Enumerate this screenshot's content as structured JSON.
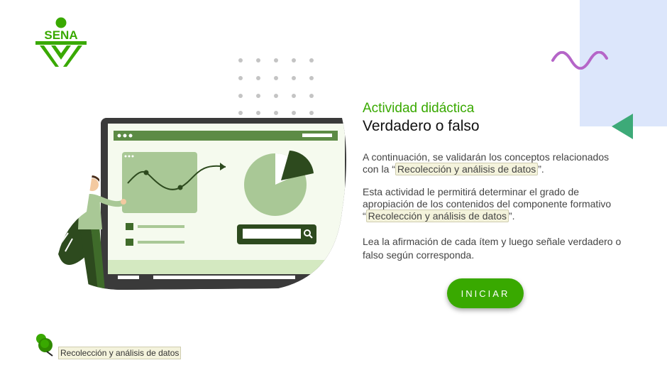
{
  "logo": {
    "text": "SENA"
  },
  "heading": {
    "eyebrow": "Actividad didáctica",
    "title": "Verdadero o falso"
  },
  "paragraphs": {
    "p1_before": "A continuación, se validarán los conceptos relacionados con la “",
    "p1_link": "Recolección y análisis de datos",
    "p1_after": "”.",
    "p2_before": "Esta actividad le permitirá determinar el grado de apropiación de los contenidos del componente formativo “",
    "p2_link": "Recolección y análisis de datos",
    "p2_after": "”.",
    "p3": "Lea la afirmación de cada ítem y luego señale verdadero o falso según corresponda."
  },
  "start_button": {
    "label": "INICIAR"
  },
  "footer": {
    "tag": "Recolección y análisis de datos"
  },
  "colors": {
    "brand_green": "#39a900",
    "panel_blue": "#dce6fb",
    "wave_purple": "#b565c8",
    "triangle_green": "#3daa78",
    "highlight": "#f4f3dc"
  },
  "icons": {
    "logo": "sena-logo-icon",
    "search": "search-icon",
    "pin": "map-pin-icon"
  }
}
